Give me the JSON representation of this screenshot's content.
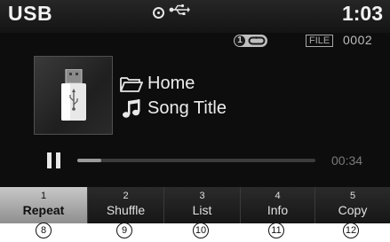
{
  "status_bar": {
    "source": "USB",
    "clock": "1:03",
    "icons": [
      "disc-icon",
      "usb-symbol-icon"
    ]
  },
  "playback_info": {
    "repeat_one_badge": "1",
    "file_tag": "FILE",
    "file_number": "0002",
    "folder_name": "Home",
    "song_title": "Song Title",
    "elapsed_time": "00:34",
    "progress_fraction": 0.1,
    "state": "playing"
  },
  "function_buttons": [
    {
      "number": "1",
      "label": "Repeat",
      "active": true
    },
    {
      "number": "2",
      "label": "Shuffle",
      "active": false
    },
    {
      "number": "3",
      "label": "List",
      "active": false
    },
    {
      "number": "4",
      "label": "Info",
      "active": false
    },
    {
      "number": "5",
      "label": "Copy",
      "active": false
    }
  ],
  "callouts": [
    "⑧",
    "⑨",
    "⑩",
    "⑪",
    "⑫"
  ],
  "colors": {
    "screen_background": "#0d0d0d",
    "active_button": "#b0b0b0",
    "text": "#ededed"
  }
}
